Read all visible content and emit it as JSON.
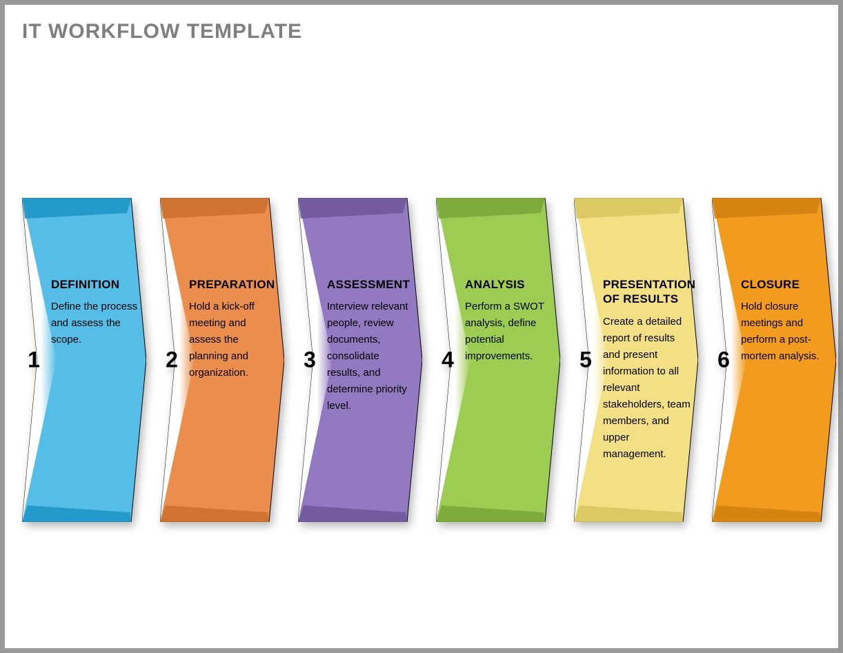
{
  "title": "IT WORKFLOW TEMPLATE",
  "steps": [
    {
      "num": "1",
      "title": "DEFINITION",
      "desc": "Define the process and assess the scope.",
      "fill": "#55BDE6",
      "dark": "#1C94C4"
    },
    {
      "num": "2",
      "title": "PREPARATION",
      "desc": "Hold a kick-off meeting and assess the planning and organization.",
      "fill": "#EB8D4C",
      "dark": "#C96E2E"
    },
    {
      "num": "3",
      "title": "ASSESSMENT",
      "desc": "Interview relevant people, review documents, consolidate results, and determine priority level.",
      "fill": "#9379C1",
      "dark": "#6E569A"
    },
    {
      "num": "4",
      "title": "ANALYSIS",
      "desc": "Perform a SWOT analysis, define potential improvements.",
      "fill": "#9CCC52",
      "dark": "#7AA53A"
    },
    {
      "num": "5",
      "title": "PRESENTATION OF RESULTS",
      "desc": "Create a detailed report of results and present information to all relevant stakeholders, team members, and upper management.",
      "fill": "#F3E084",
      "dark": "#D6C45E"
    },
    {
      "num": "6",
      "title": "CLOSURE",
      "desc": "Hold closure meetings and perform a post-mortem analysis.",
      "fill": "#F29B1E",
      "dark": "#D07F0F"
    }
  ]
}
